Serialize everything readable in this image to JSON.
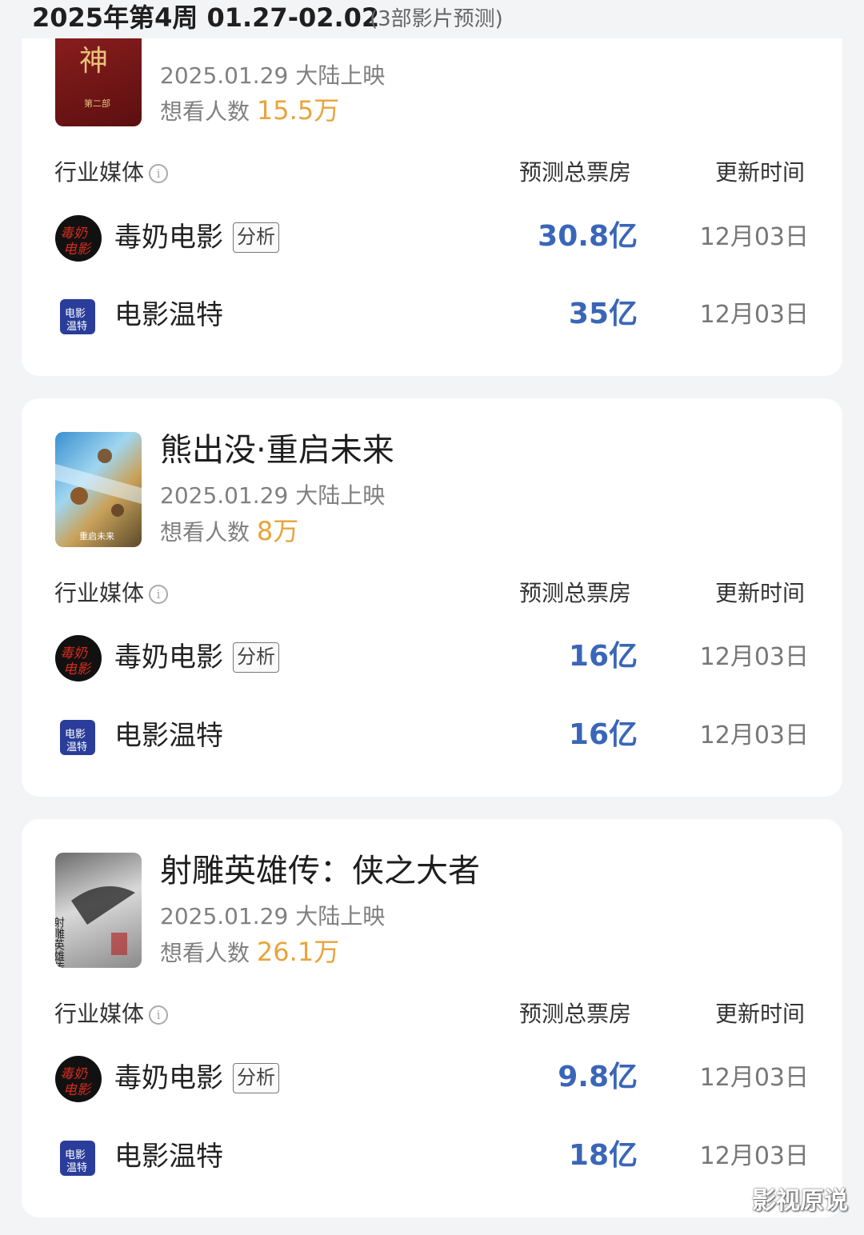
{
  "header": {
    "title": "2025年第4周 01.27-02.02",
    "subtitle": "(3部影片预测)"
  },
  "columns": {
    "media": "行业媒体",
    "box_office": "预测总票房",
    "update": "更新时间",
    "info_icon": "info-icon"
  },
  "movies": [
    {
      "title": "",
      "poster_chars": "神",
      "poster_small": "第二部",
      "release": "2025.01.29 大陆上映",
      "want_label": "想看人数",
      "want_count": "15.5万",
      "forecasts": [
        {
          "media": "毒奶电影",
          "tag": "分析",
          "value": "30.8亿",
          "time": "12月03日"
        },
        {
          "media": "电影温特",
          "tag": "",
          "value": "35亿",
          "time": "12月03日"
        }
      ]
    },
    {
      "title": "熊出没·重启未来",
      "poster_small": "重启未来",
      "release": "2025.01.29 大陆上映",
      "want_label": "想看人数",
      "want_count": "8万",
      "forecasts": [
        {
          "media": "毒奶电影",
          "tag": "分析",
          "value": "16亿",
          "time": "12月03日"
        },
        {
          "media": "电影温特",
          "tag": "",
          "value": "16亿",
          "time": "12月03日"
        }
      ]
    },
    {
      "title": "射雕英雄传：侠之大者",
      "poster_chars": "射雕英雄传",
      "release": "2025.01.29 大陆上映",
      "want_label": "想看人数",
      "want_count": "26.1万",
      "forecasts": [
        {
          "media": "毒奶电影",
          "tag": "分析",
          "value": "9.8亿",
          "time": "12月03日"
        },
        {
          "media": "电影温特",
          "tag": "",
          "value": "18亿",
          "time": "12月03日"
        }
      ]
    }
  ],
  "logos": {
    "dunai": "毒奶电影",
    "wente": "温特"
  },
  "watermark": "影视原说",
  "colors": {
    "accent_blue": "#3a66b8",
    "want_orange": "#e8a43a",
    "card_bg": "#ffffff",
    "page_bg": "#f3f4f6"
  }
}
